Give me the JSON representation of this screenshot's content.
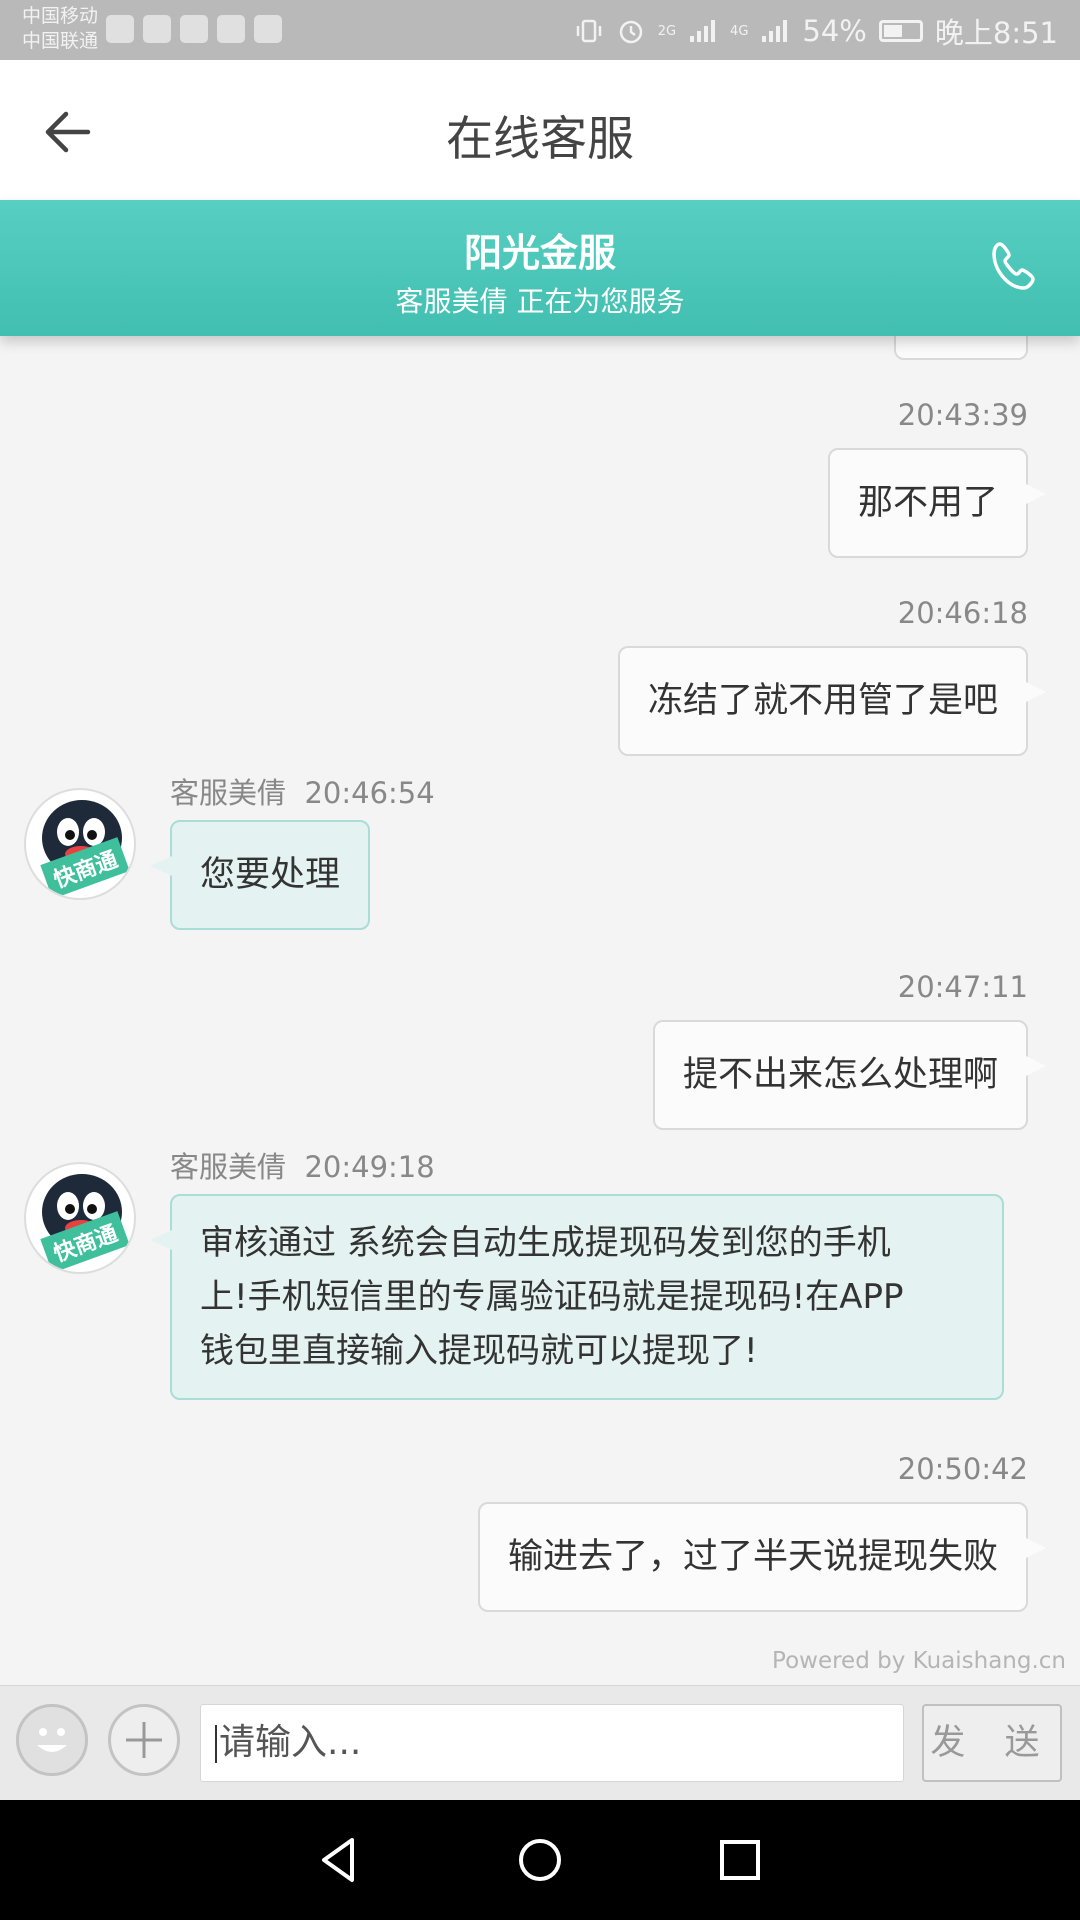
{
  "status_bar": {
    "carrier1": "中国移动",
    "carrier2": "中国联通",
    "network1": "2G",
    "network2": "4G",
    "battery": "54%",
    "time": "晚上8:51"
  },
  "header": {
    "title": "在线客服",
    "service_name": "阳光金服",
    "service_status": "客服美倩 正在为您服务"
  },
  "messages": [
    {
      "time": "20:43:39",
      "text": "那不用了"
    },
    {
      "time": "20:46:18",
      "text": "冻结了就不用管了是吧"
    },
    {
      "agent": "客服美倩",
      "time": "20:46:54",
      "text": "您要处理",
      "avatar_badge": "快商通"
    },
    {
      "time": "20:47:11",
      "text": "提不出来怎么处理啊"
    },
    {
      "agent": "客服美倩",
      "time": "20:49:18",
      "text_lines": [
        "审核通过 系统会自动生成提现码发到您的手机",
        "上!手机短信里的专属验证码就是提现码!在APP",
        "钱包里直接输入提现码就可以提现了!"
      ],
      "avatar_badge": "快商通"
    },
    {
      "time": "20:50:42",
      "text": "输进去了，过了半天说提现失败"
    }
  ],
  "powered_by": "Powered by Kuaishang.cn",
  "input": {
    "placeholder": "请输入...",
    "send_label": "发 送"
  },
  "colors": {
    "teal": "#4cc7b9",
    "bubble_in": "#e4f3f1"
  }
}
